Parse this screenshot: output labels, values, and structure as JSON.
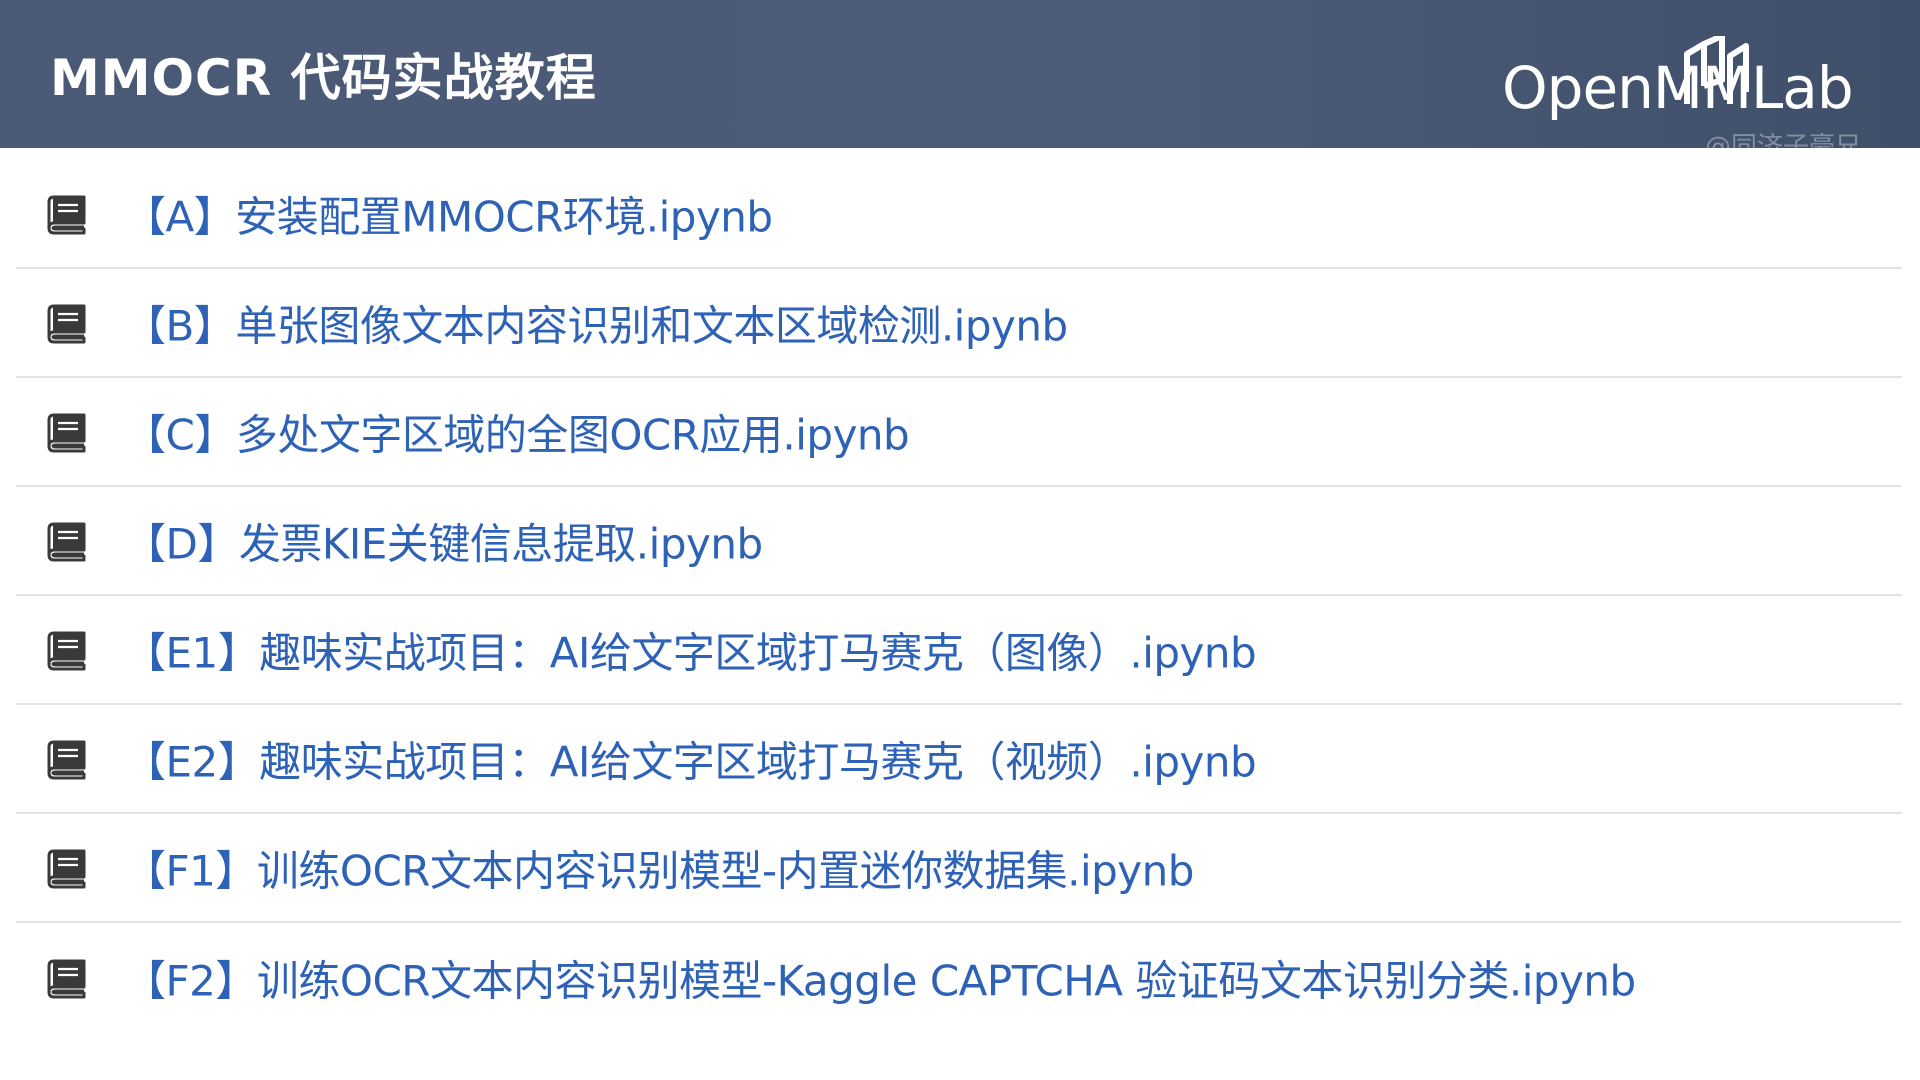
{
  "header": {
    "title": "MMOCR 代码实战教程",
    "logo_text": "OpenMMLab",
    "watermark": "@同济子豪兄"
  },
  "colors": {
    "header_bg": "#4b5b77",
    "link_text": "#2e62b6",
    "divider": "#e1e3e7",
    "icon": "#3a3a3a"
  },
  "items": [
    {
      "label": "【A】安装配置MMOCR环境.ipynb",
      "icon": "notebook-icon"
    },
    {
      "label": "【B】单张图像文本内容识别和文本区域检测.ipynb",
      "icon": "notebook-icon"
    },
    {
      "label": "【C】多处文字区域的全图OCR应用.ipynb",
      "icon": "notebook-icon"
    },
    {
      "label": "【D】发票KIE关键信息提取.ipynb",
      "icon": "notebook-icon"
    },
    {
      "label": "【E1】趣味实战项目：AI给文字区域打马赛克（图像）.ipynb",
      "icon": "notebook-icon"
    },
    {
      "label": "【E2】趣味实战项目：AI给文字区域打马赛克（视频）.ipynb",
      "icon": "notebook-icon"
    },
    {
      "label": "【F1】训练OCR文本内容识别模型-内置迷你数据集.ipynb",
      "icon": "notebook-icon"
    },
    {
      "label": "【F2】训练OCR文本内容识别模型-Kaggle CAPTCHA 验证码文本识别分类.ipynb",
      "icon": "notebook-icon"
    }
  ]
}
